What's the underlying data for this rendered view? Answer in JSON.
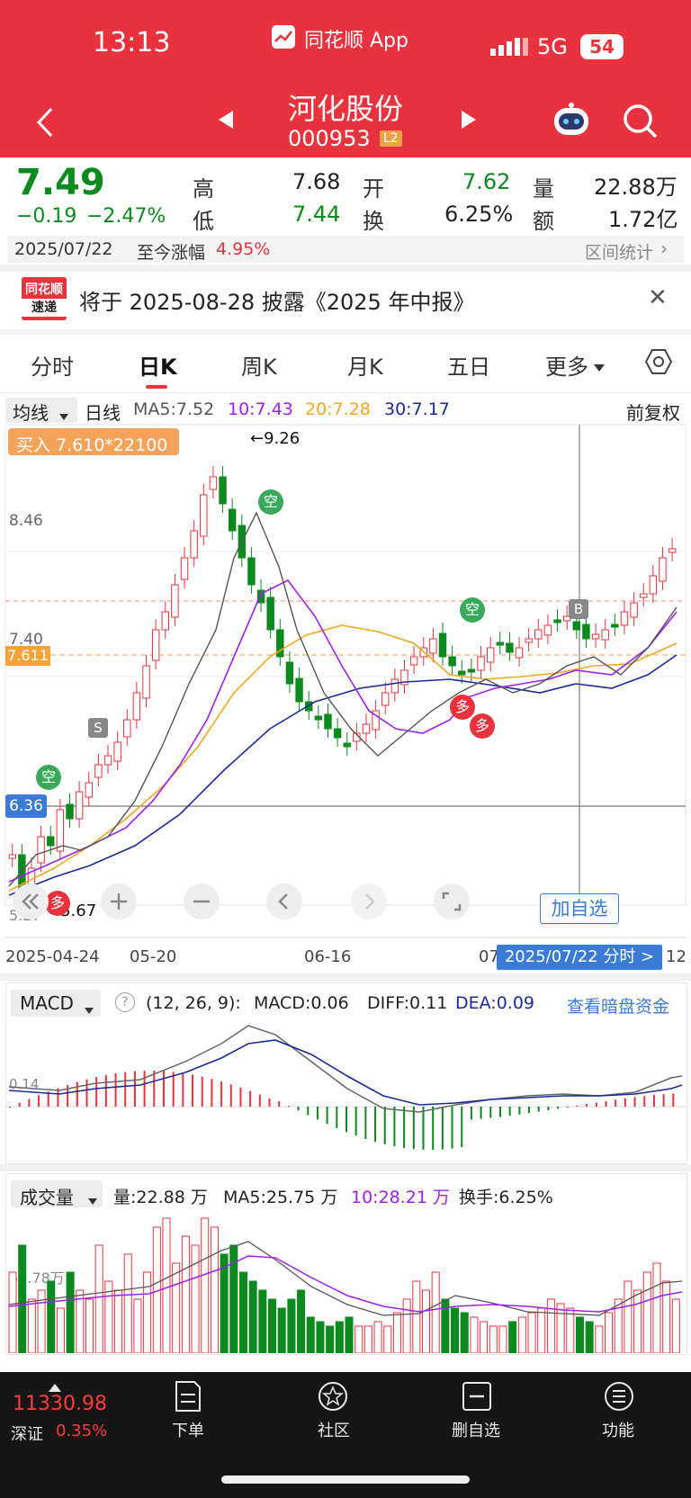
{
  "status": {
    "time": "13:13",
    "app": "同花顺 App",
    "network": "5G",
    "battery": "54"
  },
  "header": {
    "title": "河化股份",
    "code": "000953",
    "badge": "L2"
  },
  "quote": {
    "price": "7.49",
    "change": "−0.19",
    "change_pct": "−2.47%",
    "high_label": "高",
    "high": "7.68",
    "open_label": "开",
    "open": "7.62",
    "vol_label": "量",
    "vol": "22.88万",
    "low_label": "低",
    "low": "7.44",
    "turn_label": "换",
    "turn": "6.25%",
    "amt_label": "额",
    "amt": "1.72亿",
    "date": "2025/07/22",
    "since_label": "至今涨幅",
    "since_val": "4.95%",
    "stats": "区间统计"
  },
  "notice": {
    "logo_top": "同花顺",
    "logo_bottom": "速递",
    "text": "将于 2025-08-28 披露《2025 年中报》"
  },
  "tabs": [
    {
      "label": "分时"
    },
    {
      "label": "日K"
    },
    {
      "label": "周K"
    },
    {
      "label": "月K"
    },
    {
      "label": "五日"
    },
    {
      "label": "更多"
    }
  ],
  "kline": {
    "ma_selector": "均线",
    "period": "日线",
    "ma5": "MA5:7.52",
    "ma10": "10:7.43",
    "ma20": "20:7.28",
    "ma30": "30:7.17",
    "adjust": "前复权",
    "buy_tag": "买入 7.610*22100",
    "price_levels": [
      "8.46",
      "7.40",
      "7.611",
      "6.36"
    ],
    "low_label": "5.27",
    "high_mark": "←9.26",
    "low_mark": "←5.67",
    "dates": [
      "2025-04-24",
      "05-20",
      "06-16",
      "07",
      "12"
    ],
    "date_tooltip": "2025/07/22 分时 >",
    "add_fav": "加自选",
    "markers": {
      "kong": "空",
      "duo": "多",
      "s": "S",
      "b": "B"
    }
  },
  "macd": {
    "selector": "MACD",
    "params": "(12, 26, 9):",
    "macd": "MACD:0.06",
    "diff": "DIFF:0.11",
    "dea": "DEA:0.09",
    "link": "查看暗盘资金",
    "level": "0.14"
  },
  "volume": {
    "selector": "成交量",
    "vol": "量:22.88 万",
    "ma5": "MA5:25.75 万",
    "ma10": "10:28.21 万",
    "turn": "换手:6.25%",
    "level": "60.78万"
  },
  "bottom": {
    "index_val": "11330.98",
    "index_name": "深证",
    "index_pct": "0.35%",
    "items": [
      {
        "label": "下单"
      },
      {
        "label": "社区"
      },
      {
        "label": "删自选"
      },
      {
        "label": "功能"
      }
    ]
  },
  "colors": {
    "brand": "#e8333f",
    "up": "#e8333f",
    "down": "#0b8a1e",
    "ma5": "#555555",
    "ma10": "#a020f0",
    "ma20": "#f5a623",
    "ma30": "#1a2a9c"
  }
}
